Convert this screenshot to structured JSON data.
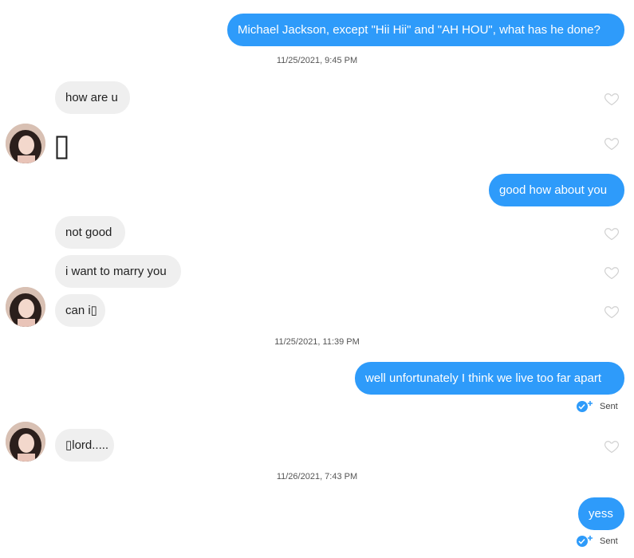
{
  "messages": {
    "m1": "Michael Jackson, except \"Hii Hii\" and \"AH HOU\",  what has he done?",
    "ts1": "11/25/2021, 9:45 PM",
    "m2": "how are u",
    "m3": "▯",
    "m4": "good how about you",
    "m5": "not good",
    "m6": "i want to marry you",
    "m7": "can i▯",
    "ts2": "11/25/2021, 11:39 PM",
    "m8": "well unfortunately I think we live too far apart",
    "sent1": "Sent",
    "m9": "▯lord.....",
    "ts3": "11/26/2021, 7:43 PM",
    "m10": "yess",
    "sent2": "Sent"
  },
  "colors": {
    "outgoing": "#2e9bfa",
    "incoming": "#efefef",
    "heart": "#d0d0d0"
  },
  "icons": [
    "heart-icon",
    "sent-check-icon",
    "avatar"
  ]
}
